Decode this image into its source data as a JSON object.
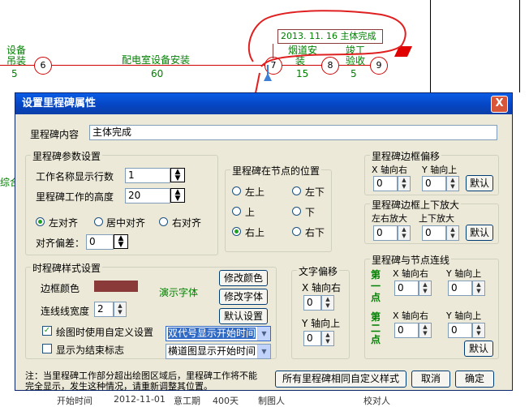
{
  "diagram": {
    "nodes": [
      "6",
      "7",
      "8",
      "9"
    ],
    "task_labels": {
      "left_top": "设备",
      "left_bottom": "吊装",
      "left_duration": "5",
      "main": "配电室设备安装",
      "main_duration": "60",
      "mid_top": "烟道安",
      "mid_bottom": "装",
      "mid_duration": "15",
      "right_top": "竣工",
      "right_bottom": "验收",
      "right_duration": "5",
      "side_left": "综合"
    },
    "milestone_box": "2013. 11. 16  主体完成",
    "bottom_row": [
      "开始时间",
      "2012-11-01",
      "意工期",
      "400天",
      "制图人",
      "校对人"
    ],
    "colors": {
      "line": "#d00000",
      "green_text": "#008000",
      "annotation": "#e02020"
    }
  },
  "dialog": {
    "title": "设置里程碑属性",
    "close_label": "X",
    "content_label": "里程碑内容",
    "content_value": "主体完成",
    "params_group": {
      "title": "里程碑参数设置",
      "rows_label": "工作名称显示行数",
      "rows_value": "1",
      "height_label": "里程碑工作的高度",
      "height_value": "20",
      "align_left": "左对齐",
      "align_center": "居中对齐",
      "align_right": "右对齐",
      "offset_label": "对齐偏差：",
      "offset_value": "0"
    },
    "position_group": {
      "title": "里程碑在节点的位置",
      "options": [
        "左上",
        "左下",
        "上",
        "下",
        "右上",
        "右下"
      ],
      "selected": "右上"
    },
    "style_group": {
      "title": "时程碑样式设置",
      "border_color_label": "边框颜色",
      "border_color": "#8b3a3a",
      "font_demo": "演示字体",
      "line_width_label": "连线线宽度",
      "line_width_value": "2",
      "custom_check_label": "绘图时使用自定义设置",
      "end_flag_label": "显示为结束标志",
      "btn_color": "修改颜色",
      "btn_font": "修改字体",
      "btn_default": "默认设置",
      "combo1": "双代号显示开始时间",
      "combo2": "横道图显示开始时间"
    },
    "text_offset_group": {
      "title": "文字偏移",
      "x_label": "X 轴向右",
      "x_value": "0",
      "y_label": "Y 轴向上",
      "y_value": "0"
    },
    "border_offset_group": {
      "title": "里程碑边框偏移",
      "x_label": "X 轴向右",
      "y_label": "Y 轴向上",
      "x_value": "0",
      "y_value": "0",
      "default_btn": "默认"
    },
    "border_scale_group": {
      "title": "里程碑边框上下放大",
      "lr_label": "左右放大",
      "ud_label": "上下放大",
      "lr_value": "0",
      "ud_value": "0",
      "default_btn": "默认"
    },
    "link_group": {
      "title": "里程碑与节点连线",
      "point1": "第一点",
      "point2": "第二点",
      "x_label": "X 轴向右",
      "y_label": "Y 轴向上",
      "p1x": "0",
      "p1y": "0",
      "p2x": "0",
      "p2y": "0",
      "default_btn": "默认"
    },
    "note": "注：当里程碑工作部分超出绘图区域后，里程碑工作将不能完全显示，发生这种情况，请重新调整其位置。",
    "btn_all_custom": "所有里程碑相同自定义样式",
    "btn_cancel": "取消",
    "btn_ok": "确定"
  }
}
